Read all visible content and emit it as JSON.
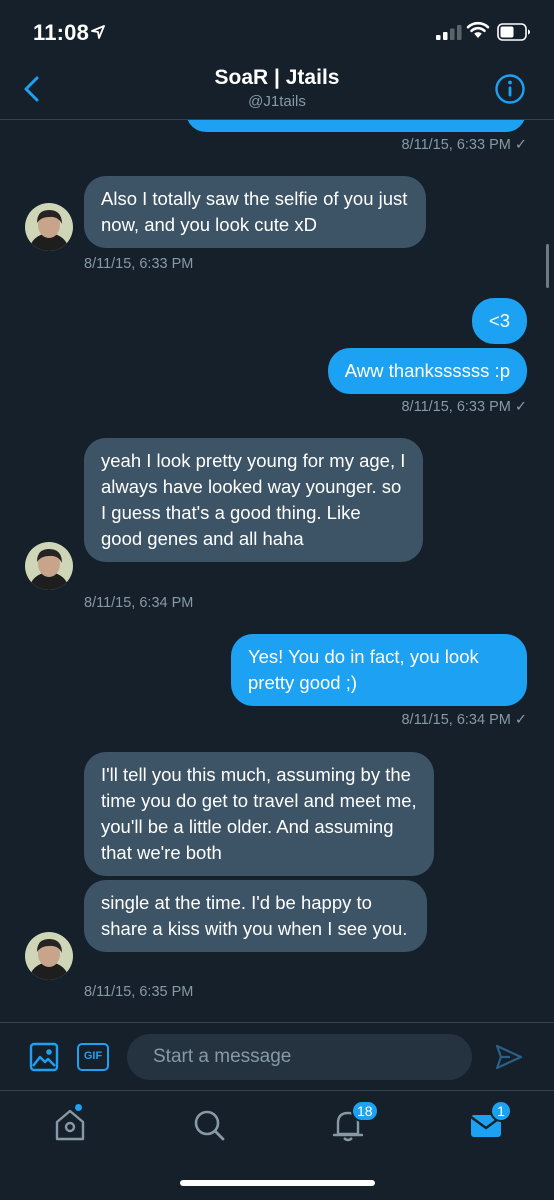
{
  "status_bar": {
    "time": "11:08"
  },
  "header": {
    "title": "SoaR | Jtails",
    "handle": "@J1tails"
  },
  "messages": [
    {
      "text": "",
      "time": "8/11/15, 6:33 PM",
      "check": "✓"
    },
    {
      "text": "Also I totally saw the selfie of you just now, and you look cute xD",
      "time": "8/11/15, 6:33 PM"
    },
    {
      "text": "<3"
    },
    {
      "text": "Aww thankssssss :p",
      "time": "8/11/15, 6:33 PM",
      "check": "✓"
    },
    {
      "text": "yeah I look pretty young for my age, I always have looked way younger. so I guess that's a good thing. Like good genes and all haha",
      "time": "8/11/15, 6:34 PM"
    },
    {
      "text": "Yes! You do in fact, you look pretty good ;)",
      "time": "8/11/15, 6:34 PM",
      "check": "✓"
    },
    {
      "text": "I'll tell you this much, assuming by the time you do get to travel and meet me, you'll be a little older. And assuming that we're both"
    },
    {
      "text": "single at the time. I'd be happy to share a kiss with you when I see you.",
      "time": "8/11/15, 6:35 PM"
    }
  ],
  "composer": {
    "gif_label": "GIF",
    "placeholder": "Start a message"
  },
  "tabbar": {
    "notifications_count": "18",
    "messages_count": "1"
  },
  "colors": {
    "background": "#15202b",
    "accent": "#1da1f2",
    "incoming_bubble": "#3d5466",
    "muted_text": "#8899a6"
  },
  "icons": [
    "location-arrow-icon",
    "signal-icon",
    "wifi-icon",
    "battery-icon",
    "back-chevron-icon",
    "info-icon",
    "image-icon",
    "gif-icon",
    "send-icon",
    "home-icon",
    "search-icon",
    "bell-icon",
    "mail-icon"
  ]
}
